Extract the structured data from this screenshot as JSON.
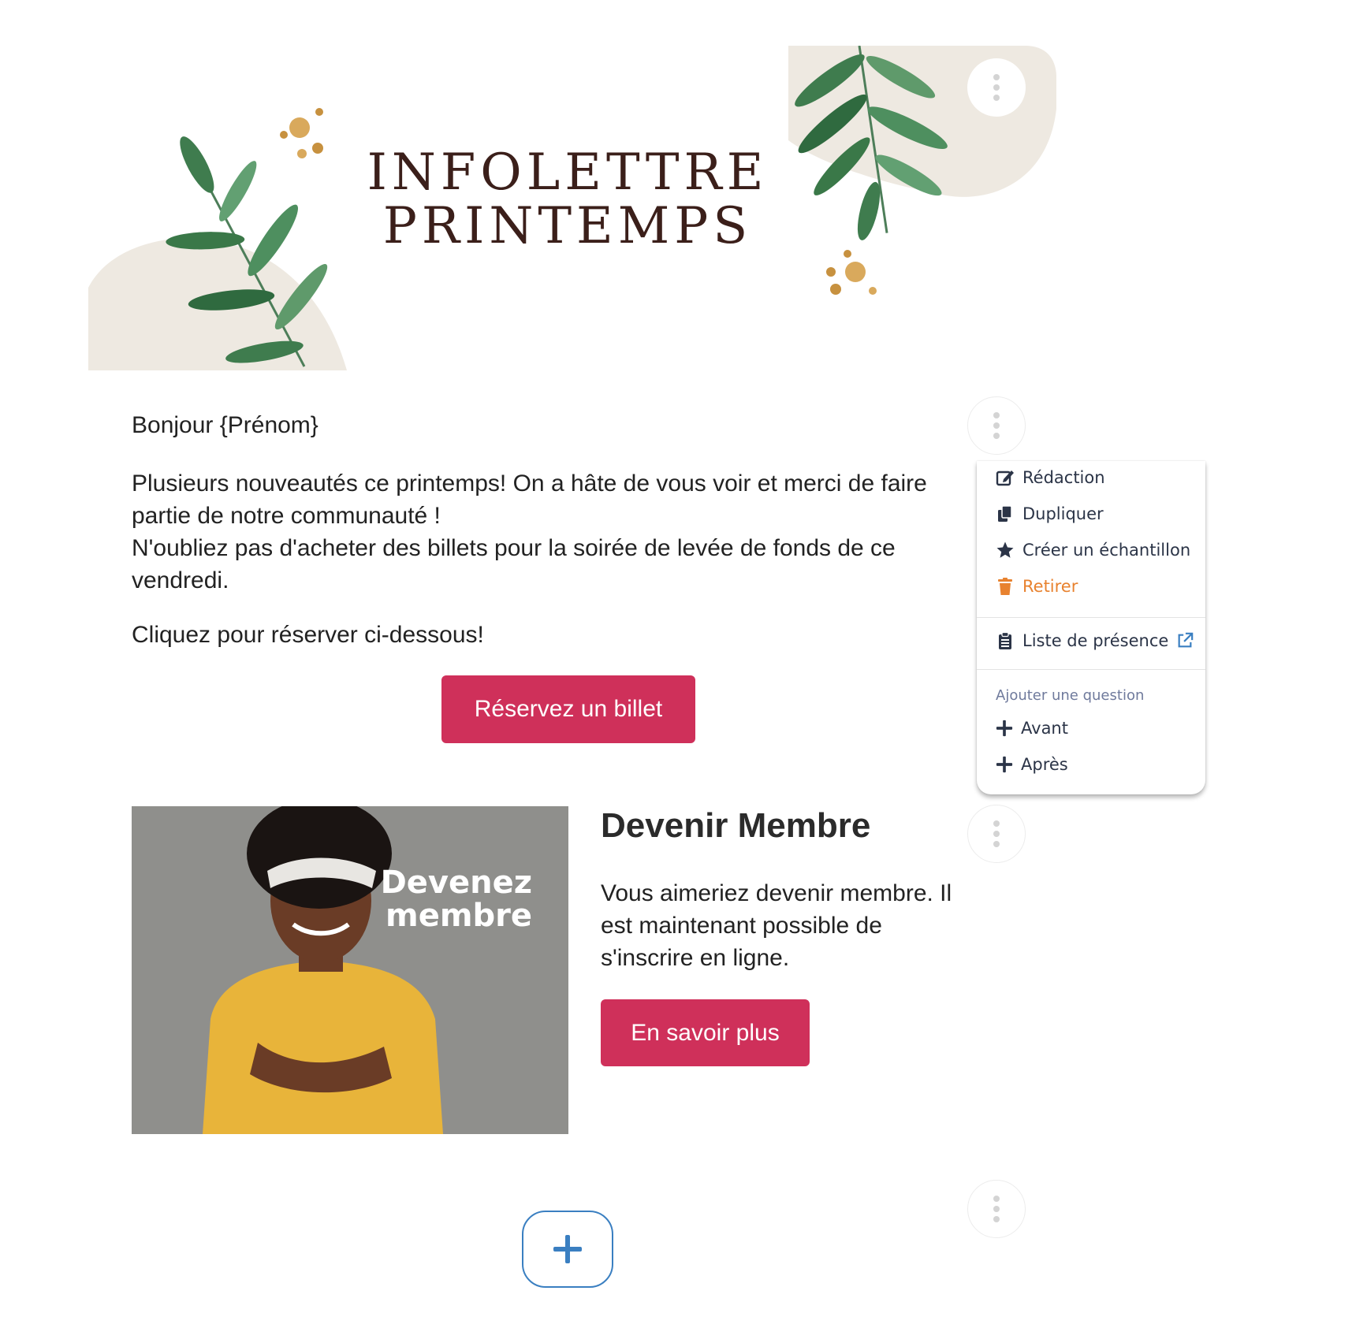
{
  "header": {
    "title_line1": "INFOLETTRE",
    "title_line2": "PRINTEMPS"
  },
  "content": {
    "greeting": "Bonjour {Prénom}",
    "paragraph_line1": "Plusieurs nouveautés ce printemps! On a hâte de vous voir et merci de faire",
    "paragraph_line2": "partie de notre communauté !",
    "paragraph_line3": "N'oubliez pas d'acheter des billets pour la soirée de levée de fonds de ce",
    "paragraph_line4": "vendredi.",
    "cta_text": "Cliquez pour réserver ci-dessous!",
    "ticket_button": "Réservez un billet"
  },
  "member": {
    "image_overlay_line1": "Devenez",
    "image_overlay_line2": "membre",
    "title": "Devenir Membre",
    "text_line1": "Vous aimeriez devenir membre. Il",
    "text_line2": "est maintenant possible de",
    "text_line3": "s'inscrire en ligne.",
    "button": "En savoir plus"
  },
  "menu": {
    "items": [
      {
        "label": "Rédaction",
        "icon": "edit-icon"
      },
      {
        "label": "Dupliquer",
        "icon": "copy-icon"
      },
      {
        "label": "Créer un échantillon",
        "icon": "star-icon"
      },
      {
        "label": "Retirer",
        "icon": "trash-icon"
      }
    ],
    "attendance": {
      "label": "Liste de présence",
      "icon": "clipboard-icon",
      "external_icon": "external-link-icon"
    },
    "section_header": "Ajouter une question",
    "add_items": [
      {
        "label": "Avant",
        "icon": "plus-icon"
      },
      {
        "label": "Après",
        "icon": "plus-icon"
      }
    ]
  },
  "colors": {
    "primary_button": "#cf305a",
    "danger_text": "#e8822f",
    "menu_text": "#2b3447",
    "menu_header": "#6f7a9c",
    "add_block_border": "#3a7fc1",
    "title_color": "#3b1f1a"
  }
}
